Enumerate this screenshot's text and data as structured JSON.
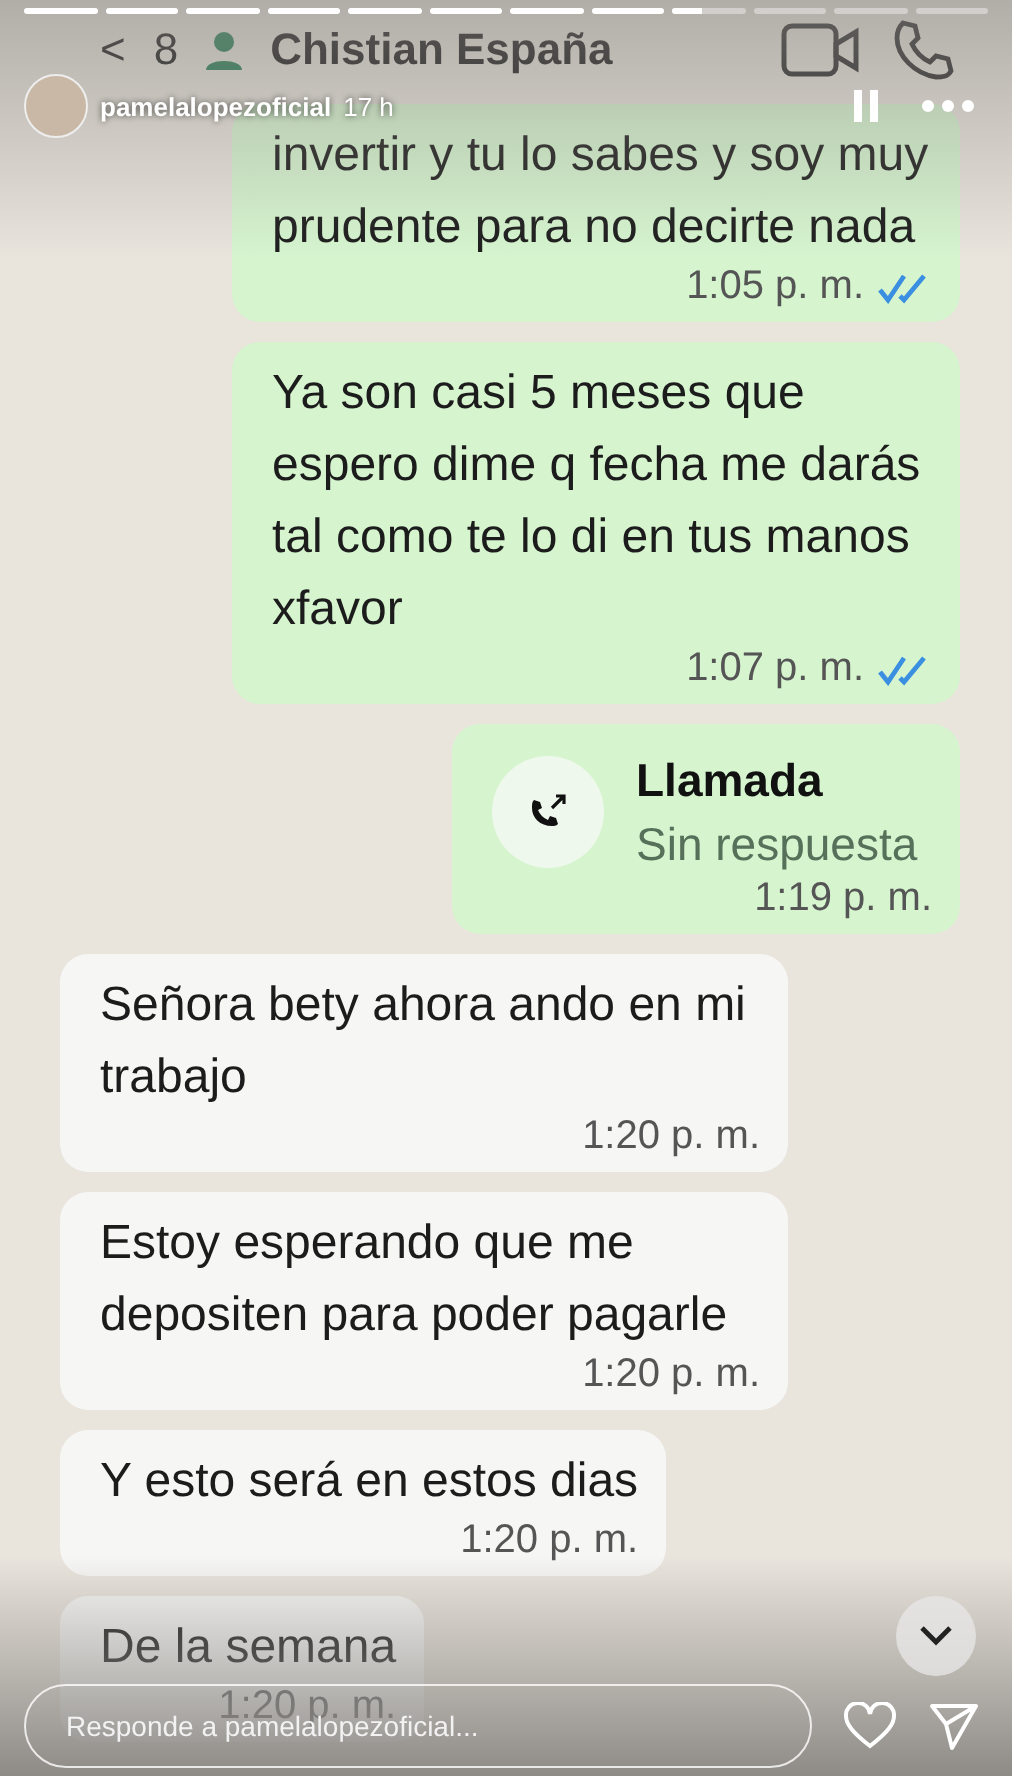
{
  "story": {
    "segments": [
      {
        "level": 1
      },
      {
        "level": 1
      },
      {
        "level": 1
      },
      {
        "level": 1
      },
      {
        "level": 1
      },
      {
        "level": 1
      },
      {
        "level": 1
      },
      {
        "level": 1
      },
      {
        "level": 0.4
      },
      {
        "level": 0
      },
      {
        "level": 0
      },
      {
        "level": 0
      }
    ],
    "user": "pamelalopezoficial",
    "age": "17 h"
  },
  "chat_header": {
    "back": "<",
    "unread": "8",
    "contact": "Chistian España"
  },
  "messages": [
    {
      "kind": "outgoing",
      "text": "invertir y tu lo sabes y soy muy prudente para no decirte nada",
      "time": "1:05 p. m.",
      "read": true
    },
    {
      "kind": "outgoing",
      "text": "Ya son casi 5 meses que espero dime q fecha me darás tal como te lo di en tus manos xfavor",
      "time": "1:07 p. m.",
      "read": true
    },
    {
      "kind": "call",
      "title": "Llamada",
      "subtitle": "Sin respuesta",
      "time": "1:19 p. m."
    },
    {
      "kind": "incoming",
      "text": "Señora bety ahora ando en mi trabajo",
      "time": "1:20 p. m."
    },
    {
      "kind": "incoming",
      "text": "Estoy esperando que me depositen para poder pagarle",
      "time": "1:20 p. m."
    },
    {
      "kind": "incoming",
      "text": "Y esto será en estos dias",
      "time": "1:20 p. m."
    },
    {
      "kind": "incoming",
      "text": "De la semana",
      "time": "1:20 p. m."
    }
  ],
  "reply": {
    "placeholder": "Responde a pamelalopezoficial..."
  }
}
